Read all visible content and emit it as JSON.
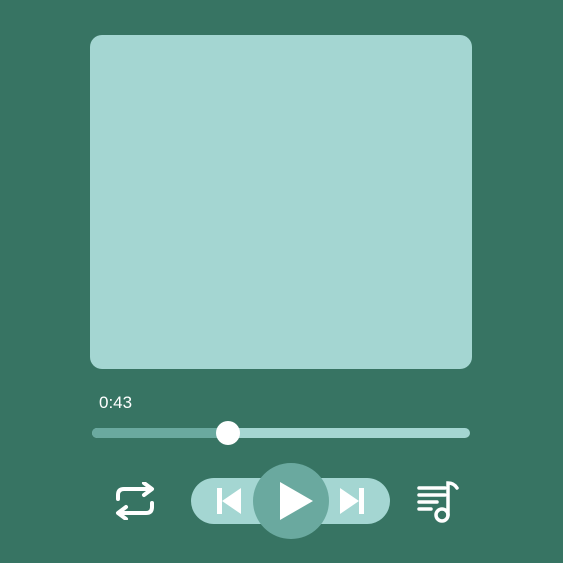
{
  "player": {
    "elapsed_time": "0:43",
    "progress_fraction": 0.36,
    "state": "paused"
  },
  "icons": {
    "repeat": "repeat-icon",
    "previous": "skip-previous-icon",
    "play": "play-icon",
    "next": "skip-next-icon",
    "queue": "music-queue-icon"
  },
  "colors": {
    "background": "#377463",
    "surface": "#a4d6d2",
    "accent": "#6aa99f",
    "foreground": "#ffffff"
  }
}
